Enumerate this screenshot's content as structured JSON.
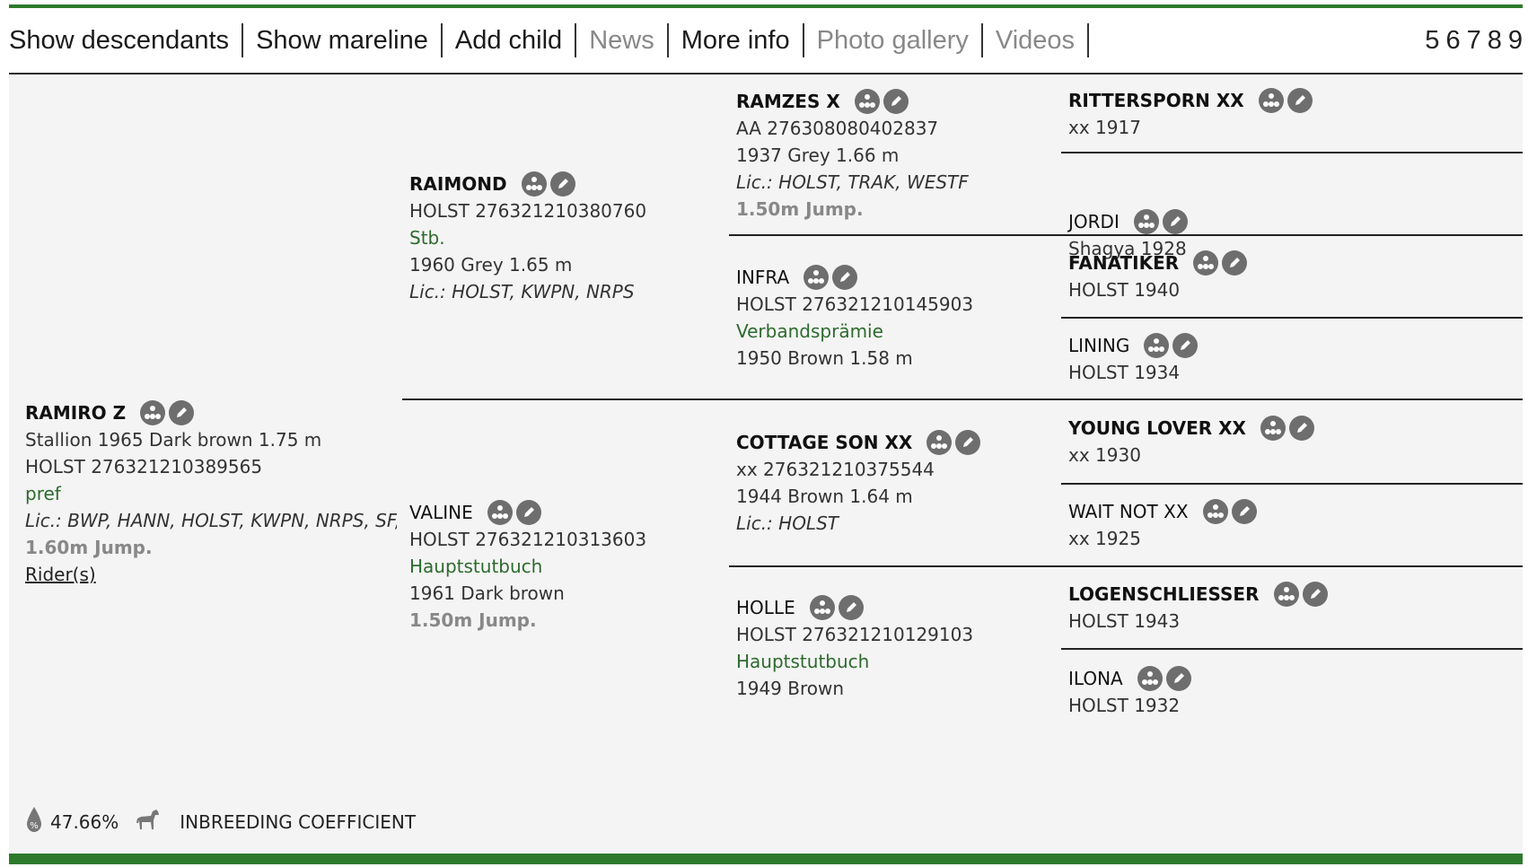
{
  "menu": {
    "items": [
      {
        "label": "Show descendants",
        "state": "active"
      },
      {
        "label": "Show mareline",
        "state": "active"
      },
      {
        "label": "Add child",
        "state": "active"
      },
      {
        "label": "News",
        "state": "inactive"
      },
      {
        "label": "More info",
        "state": "active"
      },
      {
        "label": "Photo gallery",
        "state": "inactive"
      },
      {
        "label": "Videos",
        "state": "inactive"
      }
    ],
    "pages": [
      "5",
      "6",
      "7",
      "8",
      "9"
    ]
  },
  "subject": {
    "name": "RAMIRO Z",
    "line1": "Stallion 1965 Dark brown 1.75 m",
    "line2": "HOLST 276321210389565",
    "status": "pref",
    "lic": "Lic.: BWP, HANN, HOLST, KWPN, NRPS, SF, WEST",
    "jump": "1.60m Jump.",
    "riders": "Rider(s)"
  },
  "parents": {
    "sire": {
      "name": "RAIMOND",
      "reg": "HOLST 276321210380760",
      "status": "Stb.",
      "info": "1960 Grey 1.65 m",
      "lic": "Lic.: HOLST, KWPN, NRPS"
    },
    "dam": {
      "name": "VALINE",
      "reg": "HOLST 276321210313603",
      "status": "Hauptstutbuch",
      "info": "1961 Dark brown",
      "jump": "1.50m Jump."
    }
  },
  "grandparents": {
    "ss": {
      "name": "RAMZES X",
      "reg": "AA 276308080402837",
      "info": "1937 Grey 1.66 m",
      "lic": "Lic.: HOLST, TRAK, WESTF",
      "jump": "1.50m Jump."
    },
    "sd": {
      "name": "INFRA",
      "reg": "HOLST 276321210145903",
      "status": "Verbandsprämie",
      "info": "1950 Brown 1.58 m"
    },
    "ds": {
      "name": "COTTAGE SON XX",
      "reg": "xx 276321210375544",
      "info": "1944 Brown 1.64 m",
      "lic": "Lic.: HOLST"
    },
    "dd": {
      "name": "HOLLE",
      "reg": "HOLST 276321210129103",
      "status": "Hauptstutbuch",
      "info": "1949 Brown"
    }
  },
  "great_grandparents": [
    {
      "name": "RITTERSPORN XX",
      "info": "xx 1917",
      "bold": true
    },
    {
      "name": "JORDI",
      "info": "Shagya 1928",
      "bold": false
    },
    {
      "name": "FANATIKER",
      "info": "HOLST 1940",
      "bold": true
    },
    {
      "name": "LINING",
      "info": "HOLST 1934",
      "bold": false
    },
    {
      "name": "YOUNG LOVER XX",
      "info": "xx 1930",
      "bold": true
    },
    {
      "name": "WAIT NOT XX",
      "info": "xx 1925",
      "bold": false
    },
    {
      "name": "LOGENSCHLIESSER",
      "info": "HOLST 1943",
      "bold": true
    },
    {
      "name": "ILONA",
      "info": "HOLST 1932",
      "bold": false
    }
  ],
  "footer": {
    "coefficient": "47.66%",
    "label": "INBREEDING COEFFICIENT"
  },
  "colors": {
    "accent": "#2d7a2d",
    "status_green": "#2d6a2d",
    "icon_grey": "#6e6e6e"
  }
}
